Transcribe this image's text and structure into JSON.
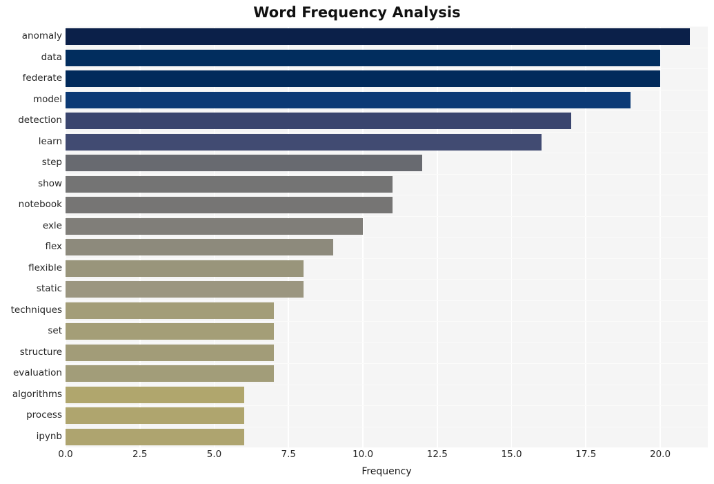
{
  "chart_data": {
    "type": "bar",
    "orientation": "horizontal",
    "title": "Word Frequency Analysis",
    "xlabel": "Frequency",
    "ylabel": "",
    "xlim": [
      0,
      21.6
    ],
    "grid": true,
    "legend": null,
    "categories": [
      "anomaly",
      "data",
      "federate",
      "model",
      "detection",
      "learn",
      "step",
      "show",
      "notebook",
      "exle",
      "flex",
      "flexible",
      "static",
      "techniques",
      "set",
      "structure",
      "evaluation",
      "algorithms",
      "process",
      "ipynb"
    ],
    "values": [
      21,
      20,
      20,
      19,
      17,
      16,
      12,
      11,
      11,
      10,
      9,
      8,
      8,
      7,
      7,
      7,
      7,
      6,
      6,
      6
    ],
    "bar_colors": [
      "#0b2049",
      "#012d5e",
      "#012a5b",
      "#0c3a75",
      "#3a456e",
      "#414b72",
      "#686a70",
      "#747474",
      "#767574",
      "#807e79",
      "#8d8a7c",
      "#99957b",
      "#9b9680",
      "#a39d78",
      "#a49e77",
      "#a29c78",
      "#a29d79",
      "#b0a66d",
      "#afa56e",
      "#aea46f"
    ],
    "xticks": [
      {
        "value": 0.0,
        "label": "0.0"
      },
      {
        "value": 2.5,
        "label": "2.5"
      },
      {
        "value": 5.0,
        "label": "5.0"
      },
      {
        "value": 7.5,
        "label": "7.5"
      },
      {
        "value": 10.0,
        "label": "10.0"
      },
      {
        "value": 12.5,
        "label": "12.5"
      },
      {
        "value": 15.0,
        "label": "15.0"
      },
      {
        "value": 17.5,
        "label": "17.5"
      },
      {
        "value": 20.0,
        "label": "20.0"
      }
    ],
    "colors": {
      "plot_background": "#f5f5f5",
      "page_background": "#ffffff",
      "gridline": "#ffffff",
      "text": "#262626",
      "title": "#111111"
    }
  }
}
